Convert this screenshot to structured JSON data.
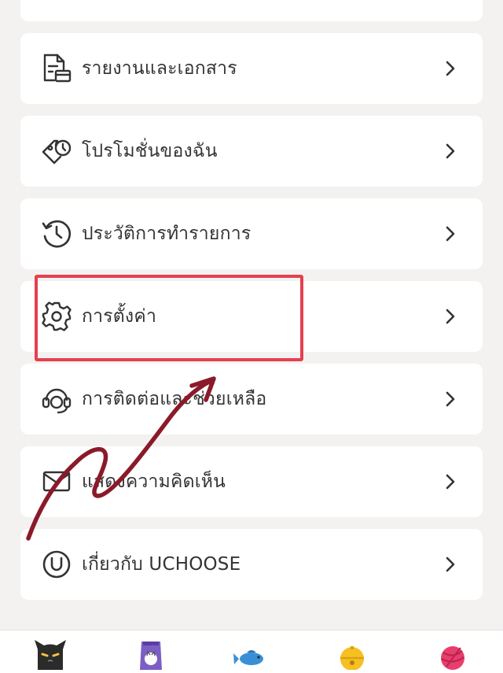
{
  "menu": {
    "items": [
      {
        "label": "รายงานและเอกสาร",
        "icon": "document-icon"
      },
      {
        "label": "โปรโมชั่นของฉัน",
        "icon": "promotion-tag-icon"
      },
      {
        "label": "ประวัติการทำรายการ",
        "icon": "history-clock-icon"
      },
      {
        "label": "การตั้งค่า",
        "icon": "gear-icon"
      },
      {
        "label": "การติดต่อและช่วยเหลือ",
        "icon": "headset-icon"
      },
      {
        "label": "แสดงความคิดเห็น",
        "icon": "feedback-mail-icon"
      },
      {
        "label": "เกี่ยวกับ UCHOOSE",
        "icon": "uchoose-logo-icon"
      }
    ]
  },
  "annotation": {
    "highlight_color": "#e5404f",
    "arrow_color": "#8a1a2a"
  },
  "bottom_nav": {
    "items": [
      "cat-face-icon",
      "cat-food-bag-icon",
      "fish-icon",
      "bell-icon",
      "yarn-ball-icon"
    ],
    "accent_color": "#f3c79a"
  }
}
